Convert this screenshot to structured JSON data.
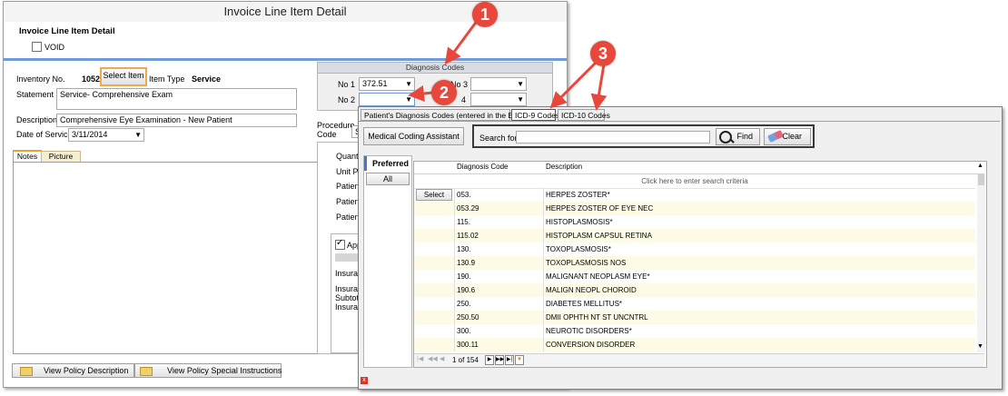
{
  "window": {
    "title": "Invoice Line Item Detail"
  },
  "header": {
    "heading": "Invoice Line Item Detail",
    "void_label": "VOID"
  },
  "form": {
    "inventory_label": "Inventory No.",
    "inventory_value": "1052",
    "select_item_label": "Select Item",
    "item_type_label": "Item Type",
    "item_type_value": "Service",
    "statement_label": "Statement",
    "statement_value": "Service- Comprehensive Exam",
    "description_label": "Description",
    "description_value": "Comprehensive Eye Examination - New Patient",
    "dos_label": "Date of Service",
    "dos_value": "3/11/2014",
    "tabs": [
      "Notes",
      "Picture"
    ],
    "procedure_label_1": "Procedure",
    "procedure_label_2": "Code",
    "procedure_value": "S",
    "quantity_label": "Quantit",
    "unit_price_label": "Unit Pric",
    "patient1_label": "Patient",
    "patient2_label": "Patient",
    "patient3_label": "Patient",
    "applied_label": "App",
    "insurance1_label": "Insuran",
    "insurance2_label": "Insuran",
    "subtotal_label": "Subtota",
    "insurance3_label": "Insuran",
    "view_policy_label": "View Policy Description",
    "view_special_label": "View Policy Special Instructions"
  },
  "diagnosis": {
    "title": "Diagnosis Codes",
    "no1_label": "No 1",
    "no1_value": "372.51",
    "no2_label": "No 2",
    "no2_value": "",
    "no3_label": "No 3",
    "no3_value": "",
    "no4_label": "4",
    "no4_value": ""
  },
  "popup": {
    "tabs": [
      "Patient's Diagnosis Codes (entered in the EMR)",
      "ICD-9 Codes",
      "ICD-10 Codes"
    ],
    "active_tab": "ICD-9 Codes",
    "coding_assistant_label": "Medical Coding Assistant",
    "search_label": "Search for",
    "search_value": "",
    "find_label": "Find",
    "clear_label": "Clear",
    "side_items": [
      "Preferred",
      "All"
    ],
    "columns": [
      "Diagnosis Code",
      "Description"
    ],
    "filter_hint": "Click here to enter search criteria",
    "select_label": "Select",
    "rows": [
      {
        "code": "053.",
        "desc": "HERPES ZOSTER*"
      },
      {
        "code": "053.29",
        "desc": "HERPES ZOSTER OF EYE NEC"
      },
      {
        "code": "115.",
        "desc": "HISTOPLASMOSIS*"
      },
      {
        "code": "115.02",
        "desc": "HISTOPLASM CAPSUL RETINA"
      },
      {
        "code": "130.",
        "desc": "TOXOPLASMOSIS*"
      },
      {
        "code": "130.9",
        "desc": "TOXOPLASMOSIS NOS"
      },
      {
        "code": "190.",
        "desc": "MALIGNANT NEOPLASM EYE*"
      },
      {
        "code": "190.6",
        "desc": "MALIGN NEOPL CHOROID"
      },
      {
        "code": "250.",
        "desc": "DIABETES MELLITUS*"
      },
      {
        "code": "250.50",
        "desc": "DMII OPHTH NT ST UNCNTRL"
      },
      {
        "code": "300.",
        "desc": "NEUROTIC DISORDERS*"
      },
      {
        "code": "300.11",
        "desc": "CONVERSION DISORDER"
      }
    ],
    "pager_text": "1 of 154"
  },
  "callouts": [
    "1",
    "2",
    "3"
  ],
  "colors": {
    "accent_blue": "#6f9bd8",
    "highlight_orange": "#f0a94e",
    "callout_red": "#e8483b",
    "row_alt": "#fdfbe6"
  }
}
